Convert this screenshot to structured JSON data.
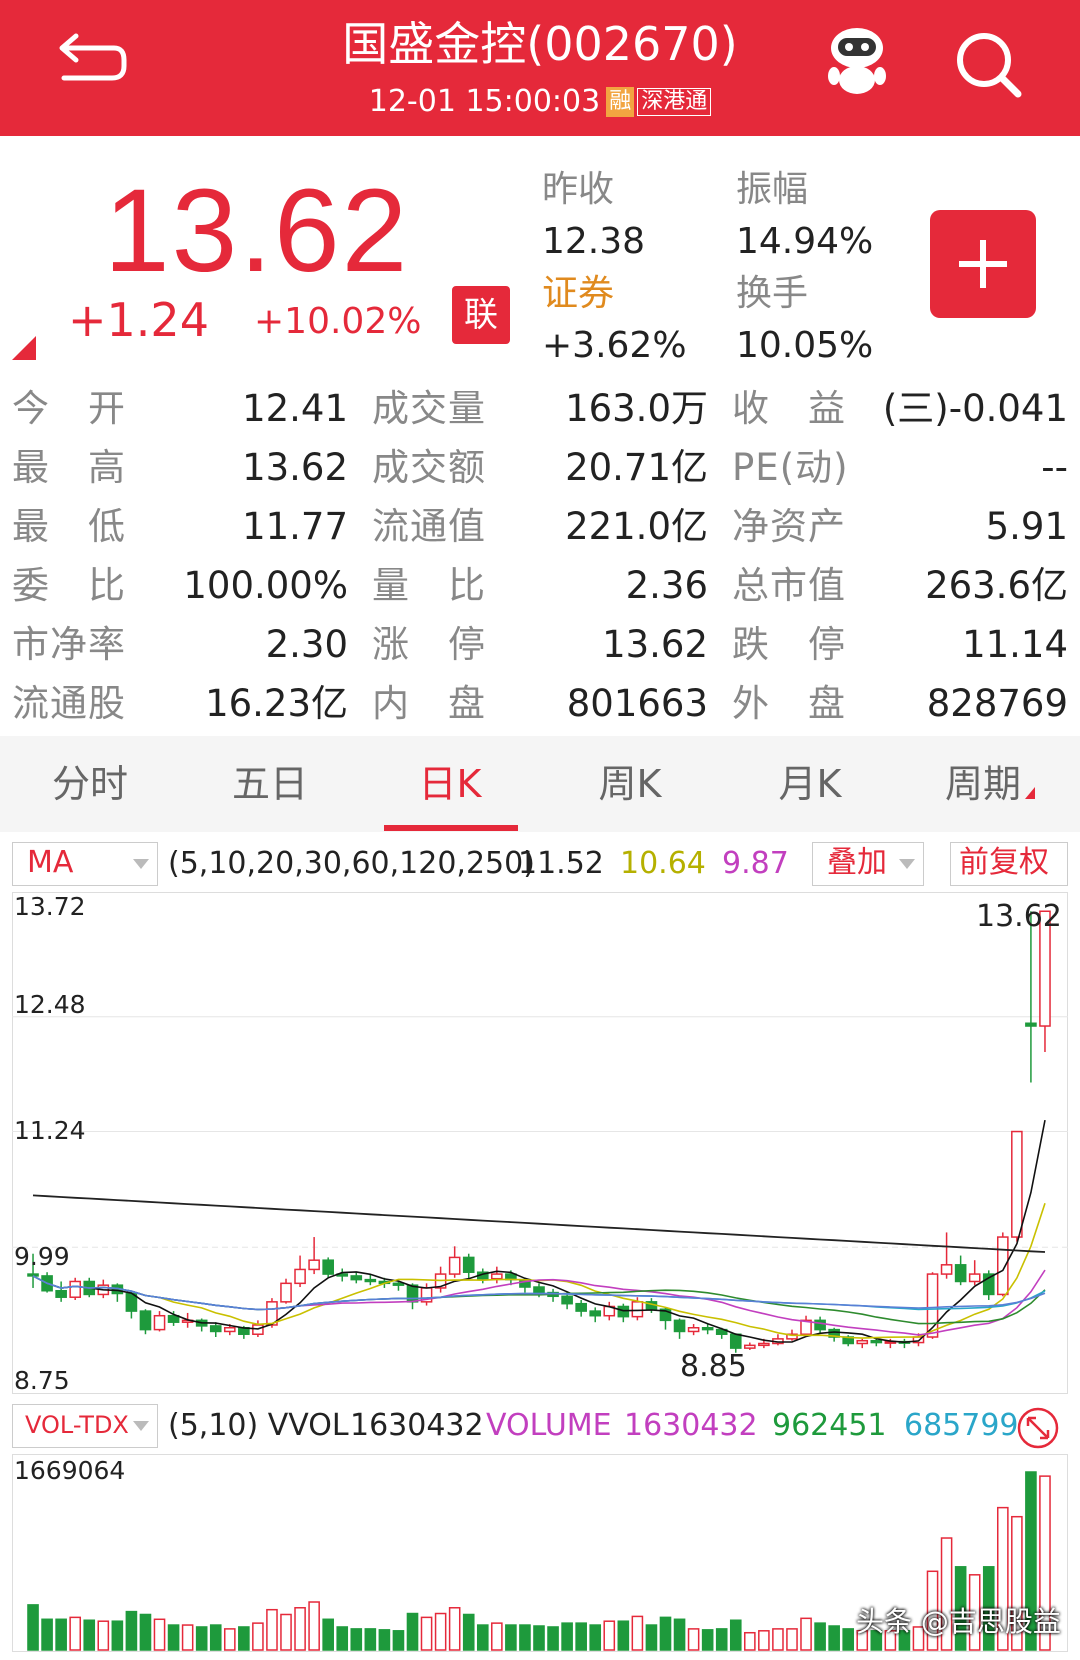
{
  "header": {
    "title": "国盛金控(002670)",
    "timestamp": "12-01 15:00:03",
    "badge_rong": "融",
    "badge_sgt": "深港通"
  },
  "quote": {
    "price": "13.62",
    "change": "+1.24",
    "change_pct": "+10.02%",
    "lian_label": "联",
    "prev_close_label": "昨收",
    "prev_close": "12.38",
    "amplitude_label": "振幅",
    "amplitude": "14.94%",
    "sector_label": "证券",
    "sector_change": "+3.62%",
    "turnover_label": "换手",
    "turnover": "10.05%"
  },
  "stats": [
    [
      {
        "label": "今　开",
        "value": "12.41"
      },
      {
        "label": "成交量",
        "value": "163.0万"
      },
      {
        "label": "收　益",
        "value": "(三)-0.041"
      }
    ],
    [
      {
        "label": "最　高",
        "value": "13.62"
      },
      {
        "label": "成交额",
        "value": "20.71亿"
      },
      {
        "label": "PE(动)",
        "value": "--"
      }
    ],
    [
      {
        "label": "最　低",
        "value": "11.77"
      },
      {
        "label": "流通值",
        "value": "221.0亿"
      },
      {
        "label": "净资产",
        "value": "5.91"
      }
    ],
    [
      {
        "label": "委　比",
        "value": "100.00%"
      },
      {
        "label": "量　比",
        "value": "2.36"
      },
      {
        "label": "总市值",
        "value": "263.6亿"
      }
    ],
    [
      {
        "label": "市净率",
        "value": "2.30"
      },
      {
        "label": "涨　停",
        "value": "13.62"
      },
      {
        "label": "跌　停",
        "value": "11.14"
      }
    ],
    [
      {
        "label": "流通股",
        "value": "16.23亿"
      },
      {
        "label": "内　盘",
        "value": "801663"
      },
      {
        "label": "外　盘",
        "value": "828769"
      }
    ]
  ],
  "tabs": [
    {
      "label": "分时"
    },
    {
      "label": "五日"
    },
    {
      "label": "日K"
    },
    {
      "label": "周K"
    },
    {
      "label": "月K"
    },
    {
      "label": "周期"
    }
  ],
  "ma_bar": {
    "selector": "MA",
    "params": "(5,10,20,30,60,120,250)",
    "v1": "11.52",
    "v2": "10.64",
    "v3": "9.87",
    "overlay": "叠加",
    "adjust": "前复权"
  },
  "vol_bar": {
    "selector": "VOL-TDX",
    "params": "(5,10) VVOL",
    "vvol": "1630432",
    "volume_label": "VOLUME",
    "volume": "1630432",
    "ma5": "962451",
    "ma10": "685799"
  },
  "kline_axis": {
    "top": "13.72",
    "l2": "12.48",
    "l3": "11.24",
    "l4": "9.99",
    "bottom": "8.75",
    "high_mark": "13.62",
    "low_mark": "8.85"
  },
  "vol_axis": {
    "top": "1669064"
  },
  "watermark": "头条 @吉思股益",
  "colors": {
    "brand": "#e5293a",
    "up": "#e5293a",
    "down": "#1e9a3c"
  },
  "chart_data": {
    "type": "candlestick",
    "ylim": [
      8.75,
      13.72
    ],
    "candles": [
      [
        9.7,
        9.68,
        9.92,
        9.55
      ],
      [
        9.68,
        9.52,
        9.72,
        9.5
      ],
      [
        9.52,
        9.45,
        9.62,
        9.4
      ],
      [
        9.45,
        9.62,
        9.66,
        9.42
      ],
      [
        9.62,
        9.48,
        9.66,
        9.45
      ],
      [
        9.48,
        9.58,
        9.64,
        9.44
      ],
      [
        9.58,
        9.49,
        9.6,
        9.4
      ],
      [
        9.49,
        9.3,
        9.52,
        9.22
      ],
      [
        9.3,
        9.1,
        9.32,
        9.05
      ],
      [
        9.1,
        9.25,
        9.3,
        9.08
      ],
      [
        9.25,
        9.18,
        9.3,
        9.14
      ],
      [
        9.18,
        9.2,
        9.28,
        9.12
      ],
      [
        9.2,
        9.14,
        9.22,
        9.08
      ],
      [
        9.14,
        9.08,
        9.18,
        9.02
      ],
      [
        9.08,
        9.12,
        9.16,
        9.04
      ],
      [
        9.12,
        9.05,
        9.14,
        9.0
      ],
      [
        9.05,
        9.15,
        9.2,
        9.02
      ],
      [
        9.15,
        9.4,
        9.44,
        9.12
      ],
      [
        9.4,
        9.6,
        9.65,
        9.38
      ],
      [
        9.6,
        9.75,
        9.9,
        9.56
      ],
      [
        9.75,
        9.85,
        10.1,
        9.7
      ],
      [
        9.85,
        9.7,
        9.88,
        9.66
      ],
      [
        9.7,
        9.68,
        9.76,
        9.62
      ],
      [
        9.68,
        9.64,
        9.72,
        9.6
      ],
      [
        9.64,
        9.62,
        9.7,
        9.58
      ],
      [
        9.62,
        9.6,
        9.66,
        9.55
      ],
      [
        9.6,
        9.58,
        9.62,
        9.52
      ],
      [
        9.58,
        9.4,
        9.6,
        9.32
      ],
      [
        9.4,
        9.55,
        9.6,
        9.36
      ],
      [
        9.55,
        9.7,
        9.78,
        9.5
      ],
      [
        9.7,
        9.88,
        10.0,
        9.66
      ],
      [
        9.88,
        9.72,
        9.92,
        9.65
      ],
      [
        9.72,
        9.65,
        9.76,
        9.6
      ],
      [
        9.65,
        9.7,
        9.78,
        9.6
      ],
      [
        9.7,
        9.64,
        9.74,
        9.58
      ],
      [
        9.64,
        9.56,
        9.66,
        9.5
      ],
      [
        9.56,
        9.5,
        9.6,
        9.45
      ],
      [
        9.5,
        9.46,
        9.54,
        9.4
      ],
      [
        9.46,
        9.38,
        9.5,
        9.32
      ],
      [
        9.38,
        9.3,
        9.42,
        9.24
      ],
      [
        9.3,
        9.25,
        9.34,
        9.18
      ],
      [
        9.25,
        9.35,
        9.4,
        9.2
      ],
      [
        9.35,
        9.24,
        9.38,
        9.18
      ],
      [
        9.24,
        9.4,
        9.45,
        9.2
      ],
      [
        9.4,
        9.32,
        9.44,
        9.28
      ],
      [
        9.32,
        9.2,
        9.34,
        9.1
      ],
      [
        9.2,
        9.08,
        9.22,
        9.0
      ],
      [
        9.08,
        9.12,
        9.16,
        9.04
      ],
      [
        9.12,
        9.1,
        9.16,
        9.05
      ],
      [
        9.1,
        9.05,
        9.12,
        9.0
      ],
      [
        9.05,
        8.9,
        9.06,
        8.85
      ],
      [
        8.9,
        8.93,
        8.96,
        8.88
      ],
      [
        8.93,
        8.95,
        9.0,
        8.9
      ],
      [
        8.95,
        9.0,
        9.05,
        8.93
      ],
      [
        9.0,
        9.05,
        9.1,
        8.98
      ],
      [
        9.05,
        9.2,
        9.25,
        9.02
      ],
      [
        9.2,
        9.1,
        9.24,
        9.06
      ],
      [
        9.1,
        9.02,
        9.12,
        8.97
      ],
      [
        9.02,
        8.95,
        9.04,
        8.92
      ],
      [
        8.95,
        8.98,
        9.0,
        8.9
      ],
      [
        8.98,
        8.96,
        9.02,
        8.92
      ],
      [
        8.96,
        8.97,
        9.0,
        8.9
      ],
      [
        8.97,
        8.96,
        9.0,
        8.9
      ],
      [
        8.96,
        9.02,
        9.06,
        8.92
      ],
      [
        9.02,
        9.7,
        9.72,
        9.0
      ],
      [
        9.7,
        9.8,
        10.15,
        9.65
      ],
      [
        9.8,
        9.62,
        9.9,
        9.58
      ],
      [
        9.62,
        9.7,
        9.85,
        9.58
      ],
      [
        9.7,
        9.48,
        9.74,
        9.42
      ],
      [
        9.48,
        10.1,
        10.15,
        9.46
      ],
      [
        10.1,
        11.24,
        11.24,
        10.05
      ],
      [
        12.41,
        12.38,
        13.62,
        11.77
      ],
      [
        12.38,
        13.62,
        13.62,
        12.1
      ]
    ]
  }
}
